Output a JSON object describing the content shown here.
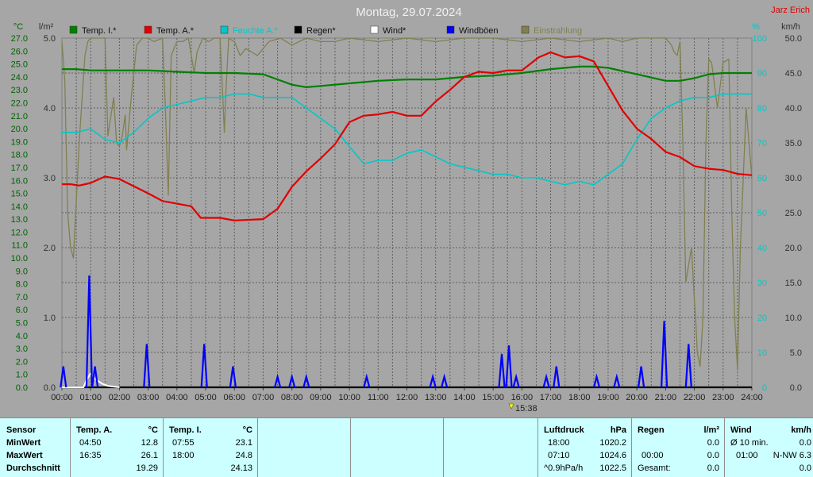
{
  "title": "Montag, 29.07.2024",
  "author": "Jarz Erich",
  "marker_label": "15:38",
  "axes": {
    "left_unit_temp": "°C",
    "left_unit_rain": "l/m²",
    "right_unit_hum": "%",
    "right_unit_wind": "km/h",
    "temp_ticks": [
      "0.0",
      "1.0",
      "2.0",
      "3.0",
      "4.0",
      "5.0",
      "6.0",
      "7.0",
      "8.0",
      "9.0",
      "10.0",
      "11.0",
      "12.0",
      "13.0",
      "14.0",
      "15.0",
      "16.0",
      "17.0",
      "18.0",
      "19.0",
      "20.0",
      "21.0",
      "22.0",
      "23.0",
      "24.0",
      "25.0",
      "26.0",
      "27.0"
    ],
    "rain_ticks": [
      "0.0",
      "1.0",
      "2.0",
      "3.0",
      "4.0",
      "5.0"
    ],
    "hum_ticks": [
      "0",
      "10",
      "20",
      "30",
      "40",
      "50",
      "60",
      "70",
      "80",
      "90",
      "100"
    ],
    "wind_ticks": [
      "0.0",
      "5.0",
      "10.0",
      "15.0",
      "20.0",
      "25.0",
      "30.0",
      "35.0",
      "40.0",
      "45.0",
      "50.0"
    ],
    "time_ticks": [
      "00:00",
      "01:00",
      "02:00",
      "03:00",
      "04:00",
      "05:00",
      "06:00",
      "07:00",
      "08:00",
      "09:00",
      "10:00",
      "11:00",
      "12:00",
      "13:00",
      "14:00",
      "15:00",
      "16:00",
      "17:00",
      "18:00",
      "19:00",
      "20:00",
      "21:00",
      "22:00",
      "23:00",
      "24:00"
    ]
  },
  "legend": [
    {
      "label": "Temp. I.*",
      "color": "#008000"
    },
    {
      "label": "Temp. A.*",
      "color": "#e00000"
    },
    {
      "label": "Feuchte A.*",
      "color": "#00c8c8"
    },
    {
      "label": "Regen*",
      "color": "#000000"
    },
    {
      "label": "Wind*",
      "color": "#ffffff"
    },
    {
      "label": "Windböen",
      "color": "#0000ff"
    },
    {
      "label": "Einstrahlung",
      "color": "#808050"
    }
  ],
  "chart_data": {
    "type": "line",
    "title": "Montag, 29.07.2024",
    "x_label": "",
    "x_range": [
      "00:00",
      "24:00"
    ],
    "temp_range": [
      0,
      27
    ],
    "rain_range": [
      0,
      5
    ],
    "humidity_range": [
      0,
      100
    ],
    "wind_range": [
      0,
      50
    ],
    "grid": true,
    "series": [
      {
        "name": "Temp. I.*",
        "unit": "°C",
        "axis": "temp",
        "color": "#008000",
        "x": [
          0,
          0.5,
          1,
          2,
          3,
          4,
          5,
          6,
          7,
          7.5,
          8,
          8.5,
          9,
          10,
          11,
          12,
          13,
          14,
          15,
          16,
          17,
          18,
          18.5,
          19,
          20,
          21,
          21.5,
          22,
          22.5,
          23,
          24
        ],
        "y": [
          24.6,
          24.6,
          24.5,
          24.5,
          24.5,
          24.4,
          24.3,
          24.3,
          24.2,
          23.8,
          23.4,
          23.2,
          23.3,
          23.5,
          23.7,
          23.8,
          23.8,
          24.0,
          24.1,
          24.3,
          24.6,
          24.8,
          24.8,
          24.7,
          24.2,
          23.7,
          23.7,
          23.9,
          24.2,
          24.3,
          24.3
        ]
      },
      {
        "name": "Temp. A.*",
        "unit": "°C",
        "axis": "temp",
        "color": "#e00000",
        "x": [
          0,
          0.3,
          0.6,
          1,
          1.5,
          2,
          3,
          3.5,
          4,
          4.5,
          4.83,
          5.5,
          6,
          7,
          7.5,
          8,
          8.5,
          9,
          9.5,
          10,
          10.5,
          11,
          11.5,
          12,
          12.5,
          13,
          13.5,
          14,
          14.5,
          15,
          15.5,
          16,
          16.58,
          17,
          17.5,
          18,
          18.5,
          19,
          19.5,
          20,
          20.5,
          21,
          21.5,
          22,
          22.5,
          23,
          23.5,
          24
        ],
        "y": [
          15.7,
          15.7,
          15.6,
          15.8,
          16.3,
          16.1,
          15.0,
          14.4,
          14.2,
          14.0,
          13.1,
          13.1,
          12.9,
          13.0,
          13.8,
          15.5,
          16.7,
          17.7,
          18.8,
          20.5,
          21.0,
          21.1,
          21.3,
          21.0,
          21.0,
          22.1,
          23.0,
          24.0,
          24.4,
          24.3,
          24.5,
          24.5,
          25.5,
          25.9,
          25.5,
          25.6,
          25.2,
          23.3,
          21.4,
          20.0,
          19.2,
          18.2,
          17.8,
          17.1,
          16.9,
          16.8,
          16.5,
          16.4
        ]
      },
      {
        "name": "Feuchte A.*",
        "unit": "%",
        "axis": "humidity",
        "color": "#00c8c8",
        "x": [
          0,
          0.5,
          1,
          1.5,
          2,
          2.5,
          3,
          3.5,
          4,
          4.5,
          5,
          5.5,
          6,
          6.5,
          7,
          7.5,
          8,
          8.5,
          9,
          9.5,
          10,
          10.5,
          11,
          11.5,
          12,
          12.5,
          13,
          13.5,
          14,
          14.5,
          15,
          15.5,
          16,
          16.5,
          17,
          17.5,
          18,
          18.5,
          19,
          19.5,
          20,
          20.5,
          21,
          21.5,
          22,
          22.5,
          23,
          23.5,
          24
        ],
        "y": [
          73,
          73,
          74,
          71,
          70,
          73,
          77,
          80,
          81,
          82,
          83,
          83,
          84,
          84,
          83,
          83,
          83,
          80,
          77,
          74,
          69,
          64,
          65,
          65,
          67,
          68,
          66,
          64,
          63,
          62,
          61,
          61,
          60,
          60,
          59,
          58,
          59,
          58,
          61,
          64,
          71,
          77,
          80,
          82,
          83,
          83,
          84,
          84,
          84
        ]
      },
      {
        "name": "Regen*",
        "unit": "l/m²",
        "axis": "rain",
        "color": "#000000",
        "x": [
          0,
          24
        ],
        "y": [
          0,
          0
        ]
      },
      {
        "name": "Wind*",
        "unit": "km/h",
        "axis": "wind",
        "color": "#ffffff",
        "x": [
          0,
          0.75,
          0.85,
          1.0,
          1.15,
          1.4,
          1.6,
          1.8,
          2.0
        ],
        "y": [
          0,
          0,
          1.0,
          2.0,
          1.2,
          0.5,
          0.2,
          0.1,
          0
        ]
      },
      {
        "name": "Windböen",
        "unit": "km/h",
        "axis": "wind",
        "color": "#0000ff",
        "bursts": [
          [
            0.05,
            3.0
          ],
          [
            0.95,
            16.0
          ],
          [
            1.15,
            3.0
          ],
          [
            2.95,
            6.2
          ],
          [
            4.95,
            6.2
          ],
          [
            5.95,
            3.0
          ],
          [
            7.5,
            1.5
          ],
          [
            8.0,
            1.5
          ],
          [
            8.5,
            1.5
          ],
          [
            10.6,
            1.5
          ],
          [
            12.9,
            1.5
          ],
          [
            13.3,
            1.5
          ],
          [
            15.3,
            4.8
          ],
          [
            15.55,
            6.0
          ],
          [
            15.8,
            1.5
          ],
          [
            16.85,
            1.5
          ],
          [
            17.2,
            3.0
          ],
          [
            18.6,
            1.5
          ],
          [
            19.3,
            1.5
          ],
          [
            20.15,
            3.0
          ],
          [
            20.95,
            9.5
          ],
          [
            21.8,
            6.2
          ]
        ]
      },
      {
        "name": "Einstrahlung",
        "unit": "%",
        "axis": "humidity",
        "color": "#808050",
        "x": [
          0,
          0.1,
          0.2,
          0.3,
          0.4,
          0.6,
          0.8,
          0.9,
          1.0,
          1.3,
          1.5,
          1.6,
          1.8,
          1.9,
          2.0,
          2.1,
          2.2,
          2.25,
          2.4,
          2.6,
          2.8,
          3.0,
          3.2,
          3.5,
          3.6,
          3.7,
          3.8,
          4.0,
          4.2,
          4.4,
          4.6,
          4.7,
          4.9,
          5.1,
          5.3,
          5.5,
          5.6,
          5.65,
          5.7,
          5.8,
          6.0,
          6.2,
          6.4,
          6.8,
          7.2,
          7.6,
          8.0,
          8.5,
          9.0,
          9.5,
          10,
          11,
          12,
          13,
          14,
          15,
          16,
          17,
          18,
          19,
          19.5,
          20,
          20.5,
          21,
          21.2,
          21.3,
          21.4,
          21.5,
          21.6,
          21.7,
          21.8,
          21.9,
          22.0,
          22.05,
          22.1,
          22.2,
          22.3,
          22.4,
          22.5,
          22.6,
          22.8,
          23.0,
          23.2,
          23.3,
          23.4,
          23.5,
          23.6,
          23.8,
          24.0
        ],
        "y": [
          99,
          88,
          50,
          40,
          37,
          70,
          95,
          99,
          100,
          100,
          100,
          72,
          83,
          70,
          69,
          72,
          78,
          68,
          82,
          98,
          100,
          100,
          99,
          100,
          80,
          55,
          95,
          99,
          99,
          100,
          90,
          96,
          100,
          99,
          100,
          100,
          82,
          73,
          84,
          100,
          99,
          95,
          97,
          95,
          99,
          100,
          98,
          100,
          99,
          99,
          100,
          99,
          100,
          99,
          100,
          100,
          99,
          100,
          99,
          100,
          99,
          100,
          100,
          100,
          98,
          96,
          95,
          99,
          70,
          30,
          35,
          40,
          25,
          19,
          10,
          6,
          20,
          70,
          94,
          93,
          80,
          93,
          94,
          50,
          20,
          5,
          40,
          80,
          60
        ]
      }
    ]
  },
  "stats": {
    "sensor_header": "Sensor",
    "row_labels": [
      "MinWert",
      "MaxWert",
      "Durchschnitt"
    ],
    "temp_a": {
      "header": "Temp. A.",
      "unit": "°C",
      "min_time": "04:50",
      "min_value": "12.8",
      "max_time": "16:35",
      "max_value": "26.1",
      "avg": "19.29"
    },
    "temp_i": {
      "header": "Temp. I.",
      "unit": "°C",
      "min_time": "07:55",
      "min_value": "23.1",
      "max_time": "18:00",
      "max_value": "24.8",
      "avg": "24.13"
    },
    "pressure": {
      "header": "Luftdruck",
      "unit": "hPa",
      "min_time": "18:00",
      "min_value": "1020.2",
      "max_time": "07:10",
      "max_value": "1024.6",
      "avg_label": "^0.9hPa/h",
      "avg": "1022.5"
    },
    "rain": {
      "header": "Regen",
      "unit": "l/m²",
      "row2_time": "00:00",
      "row2_value": "0.0",
      "row1_value": "0.0",
      "total_label": "Gesamt:",
      "total": "0.0"
    },
    "wind": {
      "header": "Wind",
      "unit": "km/h",
      "row1_label": "Ø 10 min.",
      "row1_value": "0.0",
      "row2_time": "01:00",
      "row2_value": "N-NW 6.3",
      "row3_value": "0.0"
    }
  }
}
